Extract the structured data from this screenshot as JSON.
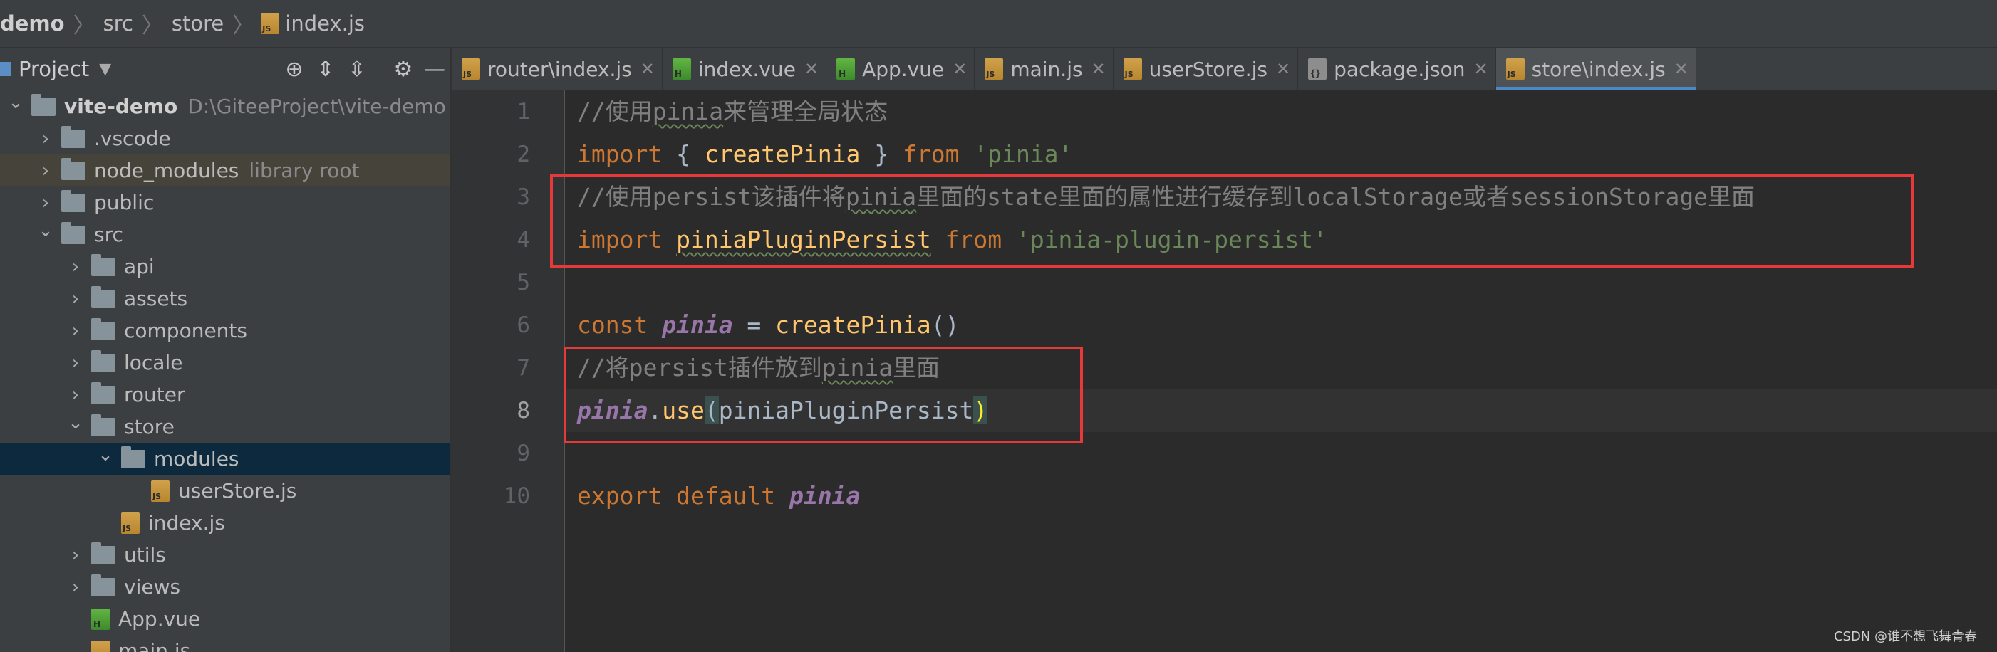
{
  "breadcrumb": {
    "items": [
      "demo",
      "src",
      "store",
      "index.js"
    ]
  },
  "project_panel": {
    "title": "Project",
    "tree": [
      {
        "label": "vite-demo",
        "hint": "D:\\GiteeProject\\vite-demo",
        "depth": 0,
        "expanded": true,
        "type": "folder-root"
      },
      {
        "label": ".vscode",
        "depth": 1,
        "expanded": false,
        "type": "folder"
      },
      {
        "label": "node_modules",
        "hint": "library root",
        "depth": 1,
        "expanded": false,
        "type": "folder"
      },
      {
        "label": "public",
        "depth": 1,
        "expanded": false,
        "type": "folder"
      },
      {
        "label": "src",
        "depth": 1,
        "expanded": true,
        "type": "folder"
      },
      {
        "label": "api",
        "depth": 2,
        "expanded": false,
        "type": "folder"
      },
      {
        "label": "assets",
        "depth": 2,
        "expanded": false,
        "type": "folder"
      },
      {
        "label": "components",
        "depth": 2,
        "expanded": false,
        "type": "folder"
      },
      {
        "label": "locale",
        "depth": 2,
        "expanded": false,
        "type": "folder"
      },
      {
        "label": "router",
        "depth": 2,
        "expanded": false,
        "type": "folder"
      },
      {
        "label": "store",
        "depth": 2,
        "expanded": true,
        "type": "folder"
      },
      {
        "label": "modules",
        "depth": 3,
        "expanded": true,
        "type": "folder"
      },
      {
        "label": "userStore.js",
        "depth": 4,
        "type": "js"
      },
      {
        "label": "index.js",
        "depth": 3,
        "type": "js"
      },
      {
        "label": "utils",
        "depth": 2,
        "expanded": false,
        "type": "folder"
      },
      {
        "label": "views",
        "depth": 2,
        "expanded": false,
        "type": "folder"
      },
      {
        "label": "App.vue",
        "depth": 2,
        "type": "vue"
      },
      {
        "label": "main.js",
        "depth": 2,
        "type": "js"
      }
    ]
  },
  "tabs": [
    {
      "label": "router\\index.js",
      "icon": "js-file-icon"
    },
    {
      "label": "index.vue",
      "icon": "vue-file-icon"
    },
    {
      "label": "App.vue",
      "icon": "vue-file-icon"
    },
    {
      "label": "main.js",
      "icon": "js-file-icon"
    },
    {
      "label": "userStore.js",
      "icon": "js-file-icon"
    },
    {
      "label": "package.json",
      "icon": "json-file-icon"
    },
    {
      "label": "store\\index.js",
      "icon": "js-file-icon",
      "active": true
    }
  ],
  "editor": {
    "current_line": 8,
    "lines": [
      {
        "n": "1",
        "tokens": [
          {
            "t": "//使用",
            "c": "comment"
          },
          {
            "t": "pinia",
            "c": "comment",
            "squiggle": true
          },
          {
            "t": "来管理全局状态",
            "c": "comment"
          }
        ]
      },
      {
        "n": "2",
        "tokens": [
          {
            "t": "import",
            "c": "keyword"
          },
          {
            "t": " { ",
            "c": "punct"
          },
          {
            "t": "createPinia",
            "c": "fn"
          },
          {
            "t": " } ",
            "c": "punct"
          },
          {
            "t": "from",
            "c": "keyword"
          },
          {
            "t": " ",
            "c": "plain"
          },
          {
            "t": "'pinia'",
            "c": "string"
          }
        ]
      },
      {
        "n": "3",
        "tokens": [
          {
            "t": "//使用persist该插件将",
            "c": "comment"
          },
          {
            "t": "pinia",
            "c": "comment",
            "squiggle": true
          },
          {
            "t": "里面的state里面的属性进行缓存到localStorage或者sessionStorage里面",
            "c": "comment"
          }
        ]
      },
      {
        "n": "4",
        "tokens": [
          {
            "t": "import",
            "c": "keyword"
          },
          {
            "t": " ",
            "c": "plain"
          },
          {
            "t": "piniaPluginPersist",
            "c": "fn",
            "squiggle": true
          },
          {
            "t": " ",
            "c": "plain"
          },
          {
            "t": "from",
            "c": "keyword"
          },
          {
            "t": " ",
            "c": "plain"
          },
          {
            "t": "'pinia-plugin-persist'",
            "c": "string"
          }
        ]
      },
      {
        "n": "5",
        "tokens": []
      },
      {
        "n": "6",
        "tokens": [
          {
            "t": "const",
            "c": "keyword"
          },
          {
            "t": " ",
            "c": "plain"
          },
          {
            "t": "pinia",
            "c": "var"
          },
          {
            "t": " = ",
            "c": "punct"
          },
          {
            "t": "createPinia",
            "c": "fn"
          },
          {
            "t": "()",
            "c": "punct"
          }
        ]
      },
      {
        "n": "7",
        "tokens": [
          {
            "t": "//将persist插件放到",
            "c": "comment"
          },
          {
            "t": "pinia",
            "c": "comment",
            "squiggle": true
          },
          {
            "t": "里面",
            "c": "comment"
          }
        ]
      },
      {
        "n": "8",
        "tokens": [
          {
            "t": "pinia",
            "c": "var"
          },
          {
            "t": ".",
            "c": "punct"
          },
          {
            "t": "use",
            "c": "fn"
          },
          {
            "t": "(",
            "c": "paren-match"
          },
          {
            "t": "piniaPluginPersist",
            "c": "plain"
          },
          {
            "t": ")",
            "c": "paren-match-bright"
          }
        ]
      },
      {
        "n": "9",
        "tokens": []
      },
      {
        "n": "10",
        "tokens": [
          {
            "t": "export",
            "c": "keyword"
          },
          {
            "t": " ",
            "c": "plain"
          },
          {
            "t": "default",
            "c": "keyword"
          },
          {
            "t": " ",
            "c": "plain"
          },
          {
            "t": "pinia",
            "c": "var"
          }
        ]
      }
    ]
  },
  "watermark": "CSDN @谁不想飞舞青春",
  "colors": {
    "background": "#2b2b2b",
    "panel": "#3c3f41",
    "keyword": "#cc7832",
    "function": "#ffc66d",
    "string": "#6a8759",
    "comment": "#808080",
    "variable": "#9876aa",
    "annotation_box": "#e63a3a",
    "active_tab_underline": "#4a88c7"
  }
}
